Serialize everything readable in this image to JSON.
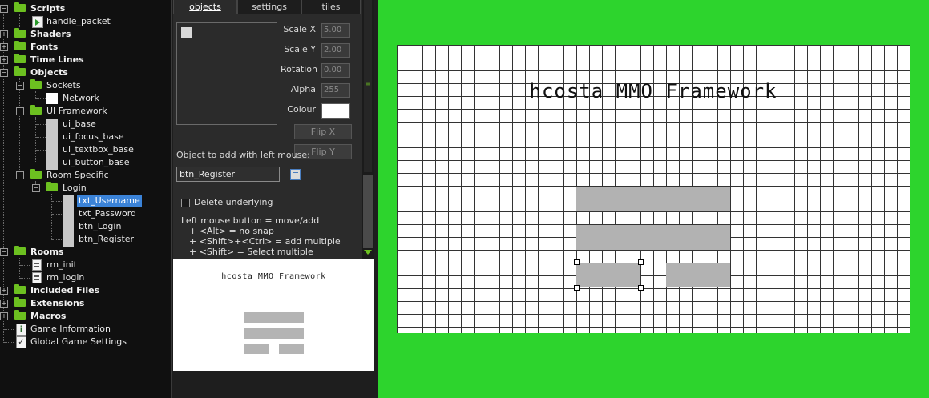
{
  "tree": {
    "scripts": "Scripts",
    "handle_packet": "handle_packet",
    "shaders": "Shaders",
    "fonts": "Fonts",
    "timelines": "Time Lines",
    "objects": "Objects",
    "sockets": "Sockets",
    "network": "Network",
    "ui_framework": "UI Framework",
    "ui_base": "ui_base",
    "ui_focus_base": "ui_focus_base",
    "ui_textbox_base": "ui_textbox_base",
    "ui_button_base": "ui_button_base",
    "room_specific": "Room Specific",
    "login": "Login",
    "txt_username": "txt_Username",
    "txt_password": "txt_Password",
    "btn_login": "btn_Login",
    "btn_register": "btn_Register",
    "rooms": "Rooms",
    "rm_init": "rm_init",
    "rm_login": "rm_login",
    "included_files": "Included Files",
    "extensions": "Extensions",
    "macros": "Macros",
    "game_information": "Game Information",
    "global_game_settings": "Global Game Settings"
  },
  "tabs": {
    "objects": "objects",
    "settings": "settings",
    "tiles": "tiles"
  },
  "props": {
    "scale_x_label": "Scale X",
    "scale_x": "5.00",
    "scale_y_label": "Scale Y",
    "scale_y": "2.00",
    "rotation_label": "Rotation",
    "rotation": "0.00",
    "alpha_label": "Alpha",
    "alpha": "255",
    "colour_label": "Colour",
    "flip_x": "Flip X",
    "flip_y": "Flip Y",
    "add_label": "Object to add with left mouse:",
    "object_value": "btn_Register",
    "delete_underlying": "Delete underlying",
    "help1": "Left mouse button = move/add",
    "help2": "+ <Alt> = no snap",
    "help3": "+ <Shift>+<Ctrl> = add multiple",
    "help4": "+ <Shift> = Select multiple"
  },
  "minimap": {
    "title": "hcosta MMO Framework"
  },
  "room": {
    "title": "hcosta MMO Framework"
  },
  "colors": {
    "room_bg": "#2dd42d",
    "selection": "#3b83d8"
  }
}
